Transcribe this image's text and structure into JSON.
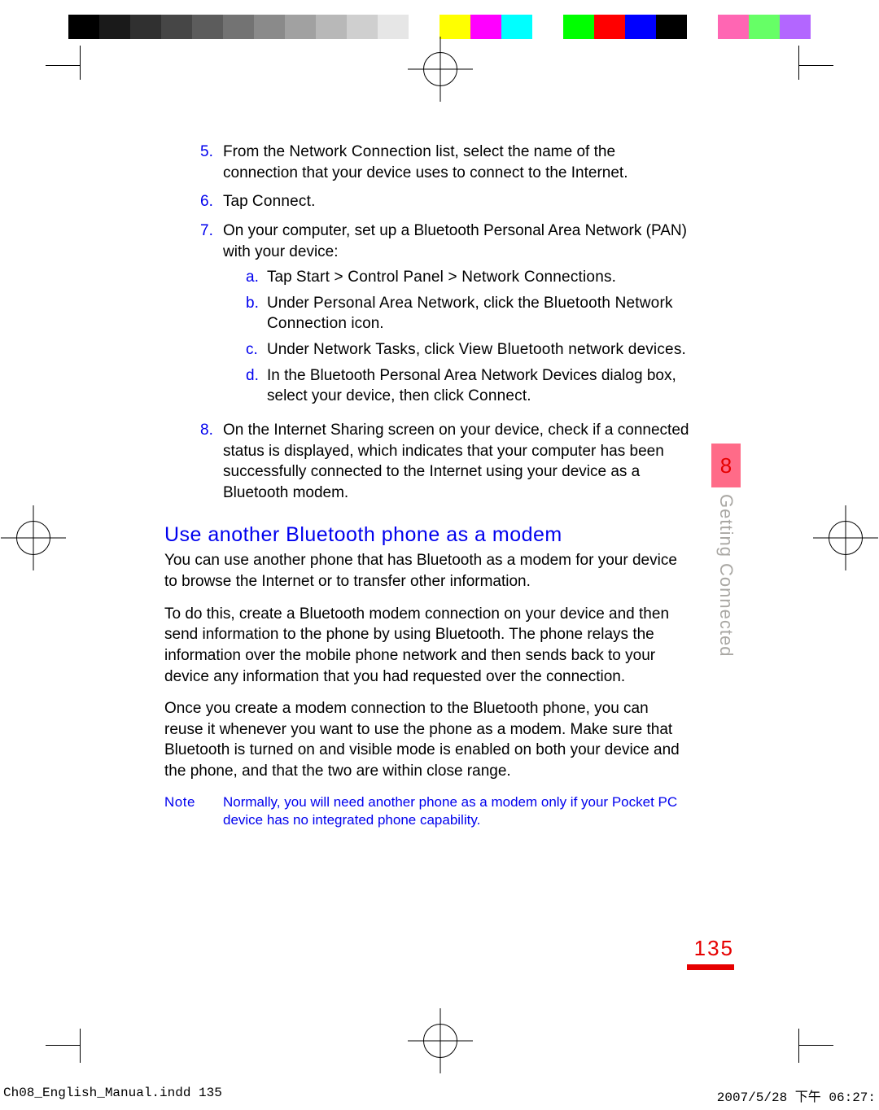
{
  "colorbar": [
    "#000000",
    "#1a1a1a",
    "#303030",
    "#464646",
    "#5c5c5c",
    "#737373",
    "#8a8a8a",
    "#a1a1a1",
    "#b8b8b8",
    "#cfcfcf",
    "#e6e6e6",
    "#ffffff",
    "#ffff00",
    "#ff00ff",
    "#00ffff",
    "#ffffff",
    "#00ff00",
    "#ff0000",
    "#0000ff",
    "#000000",
    "#ffffff",
    "#ff66b3",
    "#66ff66",
    "#b366ff"
  ],
  "chapter": {
    "number": "8",
    "title": "Getting Connected"
  },
  "page_number": "135",
  "steps": {
    "s5": {
      "marker": "5.",
      "pre": "From the ",
      "ui1": "Network Connection",
      "post": " list, select the name of the connection that your device uses to connect to the Internet."
    },
    "s6": {
      "marker": "6.",
      "pre": "Tap ",
      "ui1": "Connect",
      "post": "."
    },
    "s7": {
      "marker": "7.",
      "text": "On your computer, set up a Bluetooth Personal Area Network (PAN) with your device:"
    },
    "s7a": {
      "marker": "a.",
      "pre": "Tap ",
      "ui1": "Start > Control Panel > Network Connections",
      "post": "."
    },
    "s7b": {
      "marker": "b.",
      "pre": "Under ",
      "ui1": "Personal Area Network",
      "mid": ", click the ",
      "ui2": "Bluetooth Network Connection",
      "post": " icon."
    },
    "s7c": {
      "marker": "c.",
      "pre": "Under ",
      "ui1": "Network Tasks",
      "mid": ", click ",
      "ui2": "View Bluetooth network devices",
      "post": "."
    },
    "s7d": {
      "marker": "d.",
      "pre": "In the Bluetooth Personal Area Network Devices dialog box, select your device, then click ",
      "ui1": "Connect",
      "post": "."
    },
    "s8": {
      "marker": "8.",
      "text": "On the Internet Sharing screen on your device, check if a connected status is displayed, which indicates that your computer has been successfully connected to the Internet using your device as a Bluetooth modem."
    }
  },
  "section_heading": "Use another Bluetooth phone as a modem",
  "paragraphs": {
    "p1": "You can use another phone that has Bluetooth as a modem for your device to browse the Internet or to transfer other information.",
    "p2": "To do this, create a Bluetooth modem connection on your device and then send information to the phone by using Bluetooth. The phone relays the information over the mobile phone network and then sends back to your device any information that you had requested over the connection.",
    "p3": "Once you create a modem connection to the Bluetooth phone, you can reuse it whenever you want to use the phone as a modem. Make sure that Bluetooth is turned on and visible mode is enabled on both your device and the phone, and that the two are within close range."
  },
  "note": {
    "label": "Note",
    "text": "Normally, you will need another phone as a modem only if your Pocket PC device has no integrated phone capability."
  },
  "footer": {
    "left": "Ch08_English_Manual.indd   135",
    "right": "2007/5/28   下午 06:27:"
  }
}
